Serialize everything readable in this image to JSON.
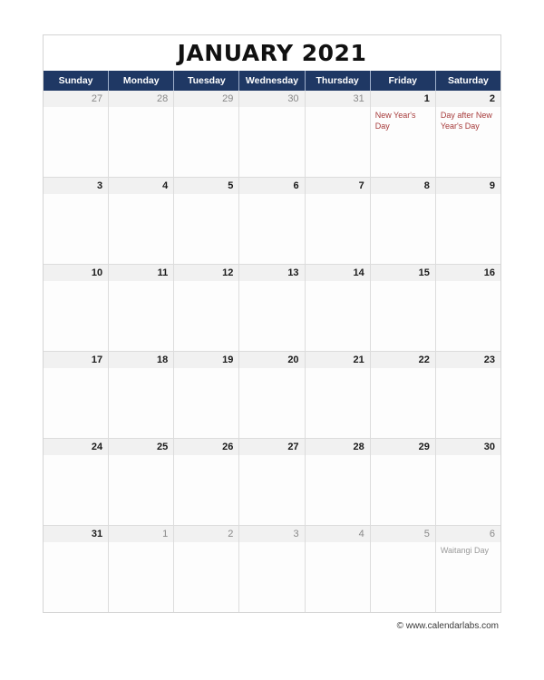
{
  "calendar": {
    "title": "JANUARY 2021",
    "accent_color": "#1F3864",
    "holiday_color": "#A63A3A",
    "weekdays": [
      "Sunday",
      "Monday",
      "Tuesday",
      "Wednesday",
      "Thursday",
      "Friday",
      "Saturday"
    ],
    "weeks": [
      [
        {
          "date": "27",
          "in_month": false,
          "events": []
        },
        {
          "date": "28",
          "in_month": false,
          "events": []
        },
        {
          "date": "29",
          "in_month": false,
          "events": []
        },
        {
          "date": "30",
          "in_month": false,
          "events": []
        },
        {
          "date": "31",
          "in_month": false,
          "events": []
        },
        {
          "date": "1",
          "in_month": true,
          "events": [
            "New Year's Day"
          ]
        },
        {
          "date": "2",
          "in_month": true,
          "events": [
            "Day after New Year's Day"
          ]
        }
      ],
      [
        {
          "date": "3",
          "in_month": true,
          "events": []
        },
        {
          "date": "4",
          "in_month": true,
          "events": []
        },
        {
          "date": "5",
          "in_month": true,
          "events": []
        },
        {
          "date": "6",
          "in_month": true,
          "events": []
        },
        {
          "date": "7",
          "in_month": true,
          "events": []
        },
        {
          "date": "8",
          "in_month": true,
          "events": []
        },
        {
          "date": "9",
          "in_month": true,
          "events": []
        }
      ],
      [
        {
          "date": "10",
          "in_month": true,
          "events": []
        },
        {
          "date": "11",
          "in_month": true,
          "events": []
        },
        {
          "date": "12",
          "in_month": true,
          "events": []
        },
        {
          "date": "13",
          "in_month": true,
          "events": []
        },
        {
          "date": "14",
          "in_month": true,
          "events": []
        },
        {
          "date": "15",
          "in_month": true,
          "events": []
        },
        {
          "date": "16",
          "in_month": true,
          "events": []
        }
      ],
      [
        {
          "date": "17",
          "in_month": true,
          "events": []
        },
        {
          "date": "18",
          "in_month": true,
          "events": []
        },
        {
          "date": "19",
          "in_month": true,
          "events": []
        },
        {
          "date": "20",
          "in_month": true,
          "events": []
        },
        {
          "date": "21",
          "in_month": true,
          "events": []
        },
        {
          "date": "22",
          "in_month": true,
          "events": []
        },
        {
          "date": "23",
          "in_month": true,
          "events": []
        }
      ],
      [
        {
          "date": "24",
          "in_month": true,
          "events": []
        },
        {
          "date": "25",
          "in_month": true,
          "events": []
        },
        {
          "date": "26",
          "in_month": true,
          "events": []
        },
        {
          "date": "27",
          "in_month": true,
          "events": []
        },
        {
          "date": "28",
          "in_month": true,
          "events": []
        },
        {
          "date": "29",
          "in_month": true,
          "events": []
        },
        {
          "date": "30",
          "in_month": true,
          "events": []
        }
      ],
      [
        {
          "date": "31",
          "in_month": true,
          "events": []
        },
        {
          "date": "1",
          "in_month": false,
          "events": []
        },
        {
          "date": "2",
          "in_month": false,
          "events": []
        },
        {
          "date": "3",
          "in_month": false,
          "events": []
        },
        {
          "date": "4",
          "in_month": false,
          "events": []
        },
        {
          "date": "5",
          "in_month": false,
          "events": []
        },
        {
          "date": "6",
          "in_month": false,
          "events": [
            "Waitangi Day"
          ]
        }
      ]
    ]
  },
  "footer": {
    "copyright": "© www.calendarlabs.com"
  }
}
